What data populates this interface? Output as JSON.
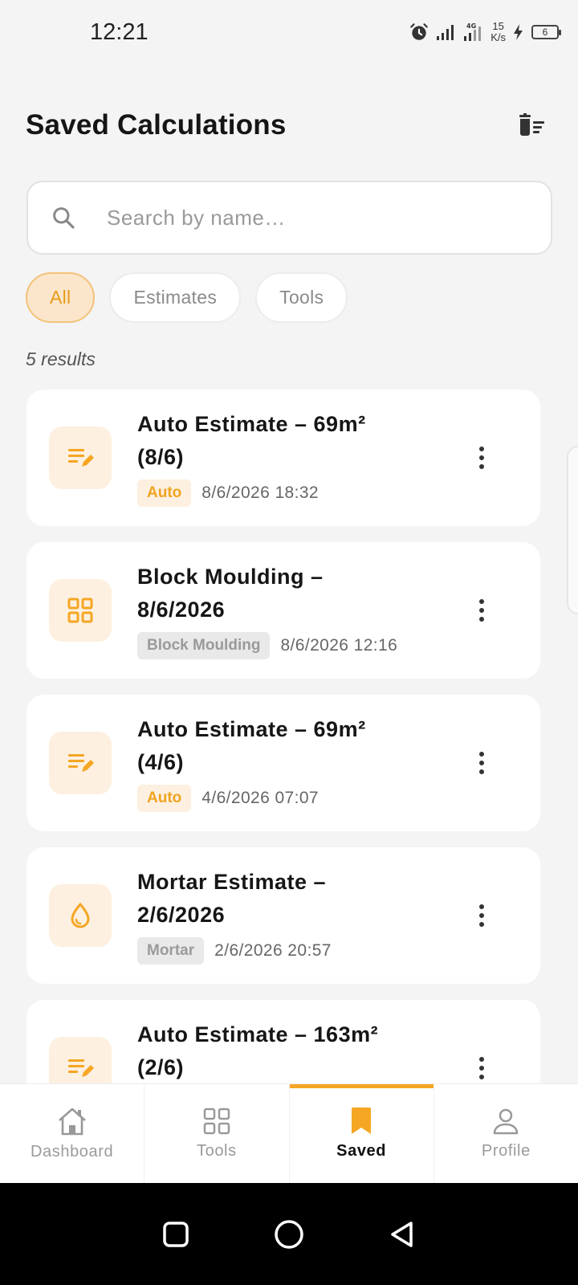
{
  "status_bar": {
    "time": "12:21",
    "net_speed_value": "15",
    "net_speed_unit": "K/s",
    "battery": "6",
    "icons": [
      "alarm-icon",
      "signal-icon",
      "4g-signal-icon",
      "charging-icon",
      "battery-icon"
    ]
  },
  "header": {
    "title": "Saved Calculations",
    "clear_icon": "delete-sweep-icon"
  },
  "search": {
    "placeholder": "Search by name…",
    "value": ""
  },
  "filters": {
    "chips": [
      {
        "label": "All",
        "active": true
      },
      {
        "label": "Estimates",
        "active": false
      },
      {
        "label": "Tools",
        "active": false
      }
    ]
  },
  "results_count": "5 results",
  "items": [
    {
      "title": "Auto Estimate – 69m² (8/6)",
      "tag": "Auto",
      "date": "8/6/2026 18:32",
      "icon": "edit-note-icon"
    },
    {
      "title": "Block Moulding – 8/6/2026",
      "tag": "Block Moulding",
      "date": "8/6/2026 12:16",
      "icon": "grid-icon"
    },
    {
      "title": "Auto Estimate – 69m² (4/6)",
      "tag": "Auto",
      "date": "4/6/2026 07:07",
      "icon": "edit-note-icon"
    },
    {
      "title": "Mortar Estimate – 2/6/2026",
      "tag": "Mortar",
      "date": "2/6/2026 20:57",
      "icon": "water-drop-icon"
    },
    {
      "title": "Auto Estimate – 163m² (2/6)",
      "tag": "",
      "date": "",
      "icon": "edit-note-icon"
    }
  ],
  "bottom_nav": {
    "items": [
      {
        "label": "Dashboard",
        "icon": "home-icon",
        "active": false
      },
      {
        "label": "Tools",
        "icon": "grid-icon",
        "active": false
      },
      {
        "label": "Saved",
        "icon": "bookmark-icon",
        "active": true
      },
      {
        "label": "Profile",
        "icon": "person-icon",
        "active": false
      }
    ]
  },
  "colors": {
    "accent": "#f5a623",
    "chip_active_bg": "#fbe6cc",
    "tag_auto_bg": "#fdf0e0",
    "tag_grey_bg": "#e9e9e9",
    "background": "#f4f4f4"
  }
}
